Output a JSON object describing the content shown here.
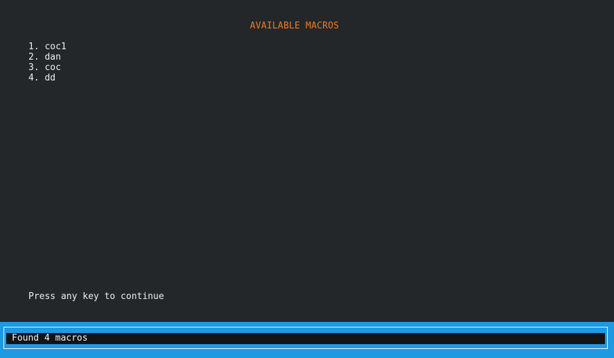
{
  "header": {
    "title": "AVAILABLE MACROS"
  },
  "macros": [
    {
      "index": "1.",
      "name": "coc1"
    },
    {
      "index": "2.",
      "name": "dan"
    },
    {
      "index": "3.",
      "name": "coc"
    },
    {
      "index": "4.",
      "name": "dd"
    }
  ],
  "prompt": {
    "text": "Press any key to continue"
  },
  "status": {
    "message": "Found 4 macros"
  },
  "colors": {
    "background": "#232729",
    "title": "#ee7a28",
    "text": "#eef0f0",
    "status_bar": "#1f9ae0",
    "status_field": "#121416"
  }
}
